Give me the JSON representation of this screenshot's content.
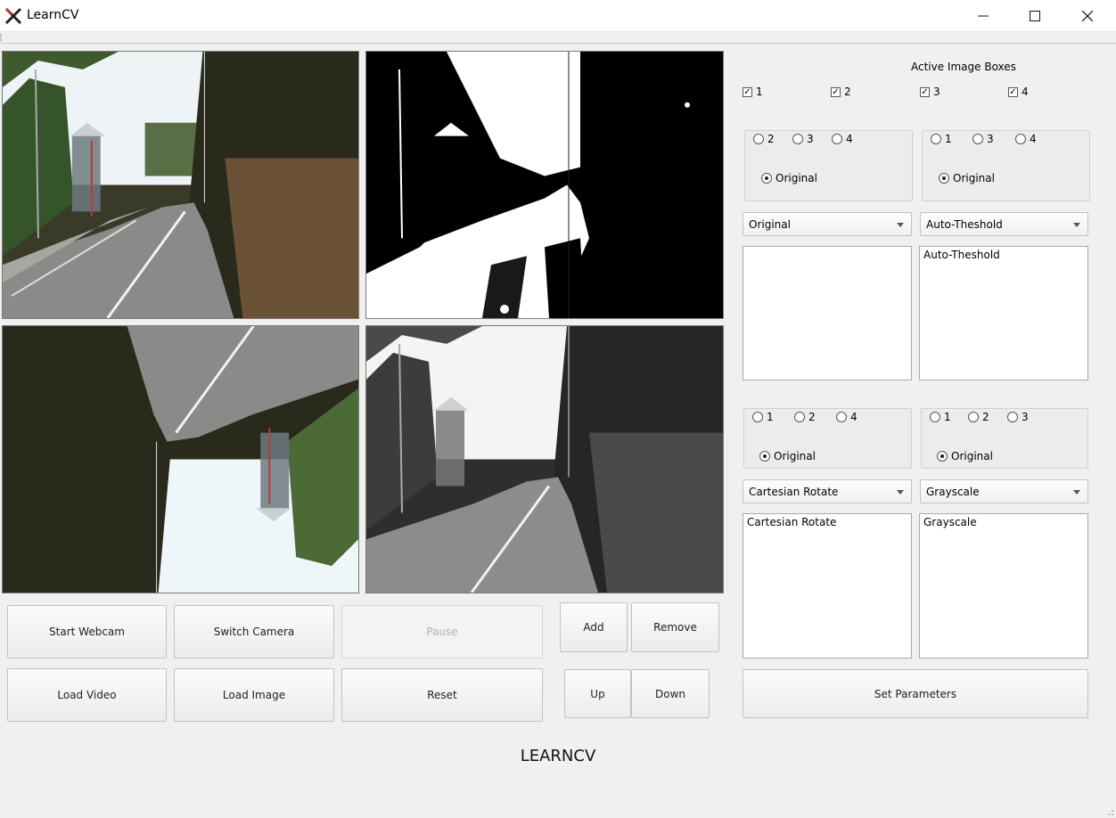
{
  "window": {
    "title": "LearnCV",
    "logo_icon": "learncv-x-logo",
    "controls": [
      "minimize",
      "maximize",
      "close"
    ]
  },
  "images": {
    "box1_content": "original road scene",
    "box2_content": "auto-threshold binary road scene",
    "box3_content": "cartesian rotated road scene",
    "box4_content": "grayscale road scene"
  },
  "buttons": {
    "start_webcam": "Start Webcam",
    "switch_camera": "Switch Camera",
    "pause": "Pause",
    "add": "Add",
    "remove": "Remove",
    "load_video": "Load Video",
    "load_image": "Load Image",
    "reset": "Reset",
    "up": "Up",
    "down": "Down",
    "set_parameters": "Set Parameters"
  },
  "active_boxes": {
    "title": "Active Image Boxes",
    "items": [
      {
        "label": "1",
        "checked": true
      },
      {
        "label": "2",
        "checked": true
      },
      {
        "label": "3",
        "checked": true
      },
      {
        "label": "4",
        "checked": true
      }
    ]
  },
  "panels": [
    {
      "radios": [
        "2",
        "3",
        "4"
      ],
      "original_label": "Original",
      "combo_value": "Original",
      "text": ""
    },
    {
      "radios": [
        "1",
        "3",
        "4"
      ],
      "original_label": "Original",
      "combo_value": "Auto-Theshold",
      "text": "Auto-Theshold"
    },
    {
      "radios": [
        "1",
        "2",
        "4"
      ],
      "original_label": "Original",
      "combo_value": "Cartesian Rotate",
      "text": "Cartesian Rotate"
    },
    {
      "radios": [
        "1",
        "2",
        "3"
      ],
      "original_label": "Original",
      "combo_value": "Grayscale",
      "text": "Grayscale"
    }
  ],
  "footer": {
    "brand": "LEARNCV"
  }
}
